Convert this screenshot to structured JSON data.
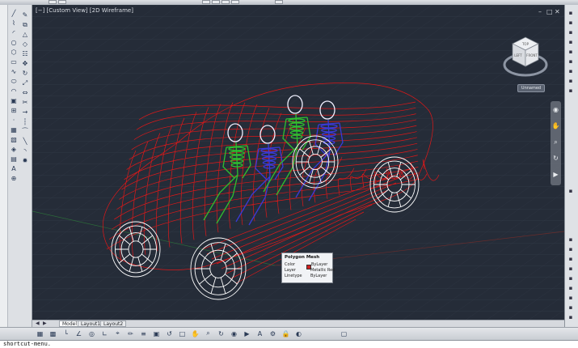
{
  "topbar": {
    "tools": [
      "qat-1",
      "qat-2",
      "qat-3",
      "qat-4",
      "qat-5",
      "qat-6",
      "qat-7"
    ]
  },
  "viewport": {
    "label": "[−] [Custom View] [2D Wireframe]",
    "background": "#252c38",
    "window_controls": {
      "minimize": "–",
      "restore": "□",
      "close": "✕"
    }
  },
  "viewcube": {
    "faces": {
      "top": "TOP",
      "front": "FRONT",
      "left": "LEFT"
    },
    "ucs_label": "Unnamed"
  },
  "model": {
    "body_color": "#e01818",
    "skeleton_colors": [
      "#2fbf2f",
      "#3a3ad8"
    ],
    "wheel_color": "#ffffff",
    "head_color": "#f0f0ff"
  },
  "tooltip": {
    "title": "Polygon Mesh",
    "rows": [
      {
        "key": "Color",
        "value": "ByLayer"
      },
      {
        "key": "Layer",
        "value": "Metallic Red"
      },
      {
        "key": "Linetype",
        "value": "ByLayer"
      }
    ],
    "swatch_color": "#d02020"
  },
  "tabs": [
    {
      "label": "Model",
      "active": true
    },
    {
      "label": "Layout1",
      "active": false
    },
    {
      "label": "Layout2",
      "active": false
    }
  ],
  "tab_nav": [
    "◀",
    "▶"
  ],
  "left_tools": [
    "line-icon",
    "polyline-icon",
    "arc-icon",
    "circle-icon",
    "polygon-icon",
    "rectangle-icon",
    "spline-icon",
    "ellipse-icon",
    "ellipse-arc-icon",
    "insert-block-icon",
    "make-block-icon",
    "point-icon",
    "hatch-icon",
    "gradient-icon",
    "region-icon",
    "table-icon",
    "mtext-icon",
    "add-selected-icon"
  ],
  "left_glyphs": [
    "╱",
    "⌇",
    "◜",
    "○",
    "⬡",
    "▭",
    "∿",
    "⬭",
    "◠",
    "▣",
    "⊞",
    "·",
    "▦",
    "▧",
    "◈",
    "▤",
    "A",
    "⊕"
  ],
  "modify_tools": [
    "erase-icon",
    "copy-icon",
    "mirror-icon",
    "offset-icon",
    "array-icon",
    "move-icon",
    "rotate-icon",
    "scale-icon",
    "stretch-icon",
    "trim-icon",
    "extend-icon",
    "break-icon",
    "join-icon",
    "chamfer-icon",
    "fillet-icon",
    "explode-icon"
  ],
  "modify_glyphs": [
    "✎",
    "⧉",
    "△",
    "◇",
    "☷",
    "✥",
    "↻",
    "⤢",
    "⇔",
    "✂",
    "→",
    "┆",
    "⁀",
    "╲",
    "◝",
    "✹"
  ],
  "status_tools": [
    "snap-icon",
    "grid-icon",
    "ortho-icon",
    "polar-icon",
    "osnap-icon",
    "otrack-icon",
    "ducs-icon",
    "dyn-icon",
    "lwt-icon",
    "qp-icon",
    "sc-icon",
    "view-icon",
    "pan-icon",
    "zoom-icon",
    "orbit-icon",
    "steering-icon",
    "showmotion-icon",
    "annotation-icon",
    "workspace-icon",
    "lock-icon",
    "isolate-icon",
    "cleanscreen-icon"
  ],
  "status_glyphs": [
    "▦",
    "▩",
    "└",
    "∠",
    "◎",
    "∟",
    "⌖",
    "✏",
    "≡",
    "▣",
    "↺",
    "□",
    "✋",
    "⌕",
    "↻",
    "◉",
    "▶",
    "A",
    "⚙",
    "🔒",
    "◐",
    "▢"
  ],
  "nav_tools": [
    "wheel-icon",
    "pan-icon",
    "zoom-icon",
    "orbit-icon",
    "showmotion-icon"
  ],
  "nav_glyphs": [
    "◉",
    "✋",
    "⌕",
    "↻",
    "▶"
  ],
  "command": {
    "text": "shortcut-menu."
  }
}
